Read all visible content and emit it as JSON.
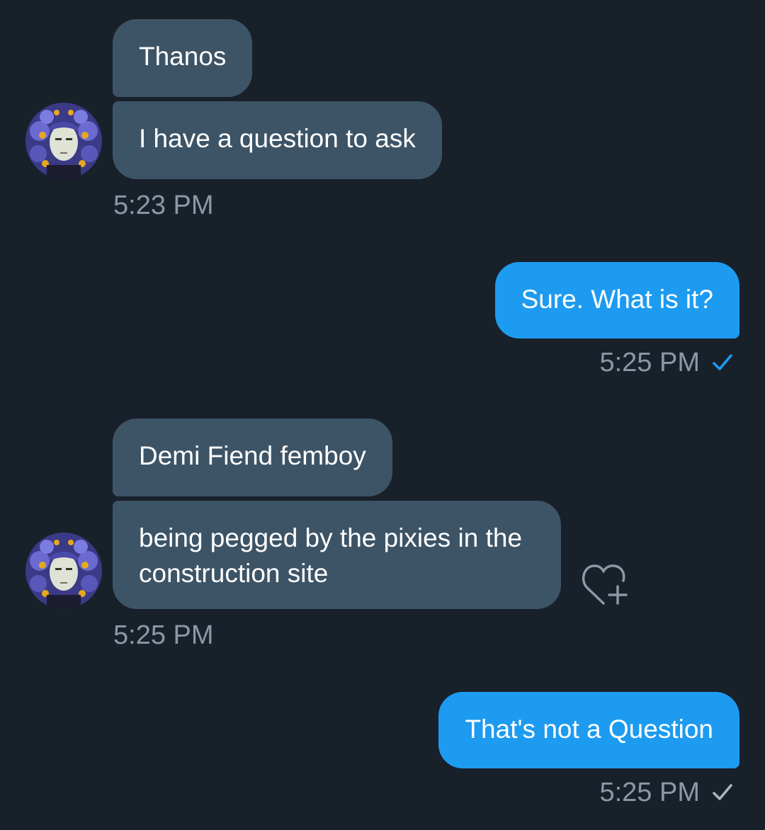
{
  "conversation": {
    "groups": [
      {
        "direction": "received",
        "messages": [
          "Thanos",
          "I have a question to ask"
        ],
        "time": "5:23 PM"
      },
      {
        "direction": "sent",
        "messages": [
          "Sure. What is it?"
        ],
        "time": "5:25 PM",
        "receipt": "read",
        "receipt_color": "#1d9bf0"
      },
      {
        "direction": "received",
        "messages": [
          "Demi Fiend femboy",
          "being pegged by the pixies in the construction site"
        ],
        "message_lines": [
          "being pegged by the pixies in the",
          "construction site"
        ],
        "time": "5:25 PM",
        "reaction_icon": "heart-plus-icon"
      },
      {
        "direction": "sent",
        "messages": [
          "That's not a Question"
        ],
        "time": "5:25 PM",
        "receipt": "sent",
        "receipt_color": "#8b98a5"
      }
    ]
  },
  "colors": {
    "background": "#18202a",
    "received_bubble": "#3d5466",
    "sent_bubble": "#1d9bf0",
    "timestamp": "#8b98a5"
  }
}
